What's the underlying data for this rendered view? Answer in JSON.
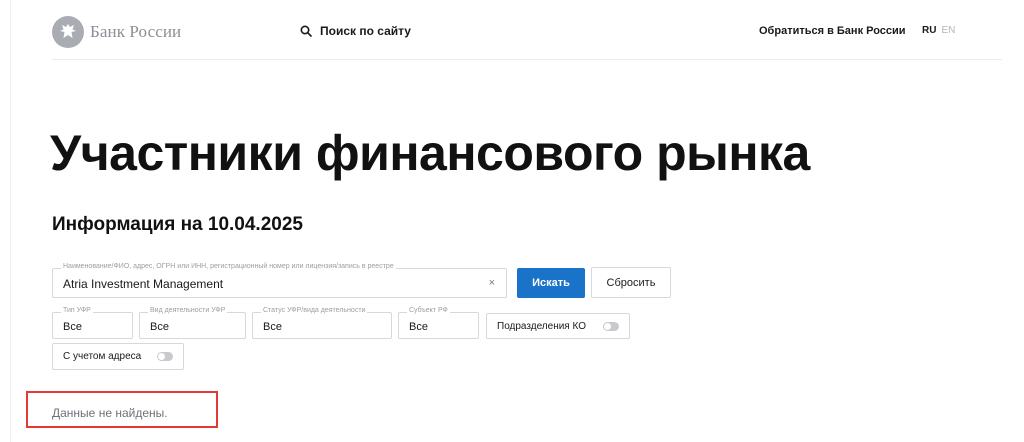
{
  "header": {
    "logo_text": "Банк России",
    "search_label": "Поиск по сайту",
    "contact_label": "Обратиться в Банк России",
    "lang_ru": "RU",
    "lang_en": "EN"
  },
  "page": {
    "title": "Участники финансового рынка",
    "info_date": "Информация на 10.04.2025"
  },
  "search": {
    "legend": "Наименование/ФИО, адрес, ОГРН или ИНН, регистрационный номер или лицензия/запись в реестре",
    "value": "Atria Investment Management",
    "clear_symbol": "×",
    "submit_label": "Искать",
    "reset_label": "Сбросить"
  },
  "filters": {
    "type": {
      "legend": "Тип УФР",
      "value": "Все"
    },
    "activity": {
      "legend": "Вид деятельности УФР",
      "value": "Все"
    },
    "status": {
      "legend": "Статус УФР/вида деятельности",
      "value": "Все"
    },
    "region": {
      "legend": "Субъект РФ",
      "value": "Все"
    },
    "branches_toggle": {
      "label": "Подразделения КО",
      "on": false
    },
    "address_toggle": {
      "label": "С учетом адреса",
      "on": false
    }
  },
  "result": {
    "message": "Данные не найдены."
  },
  "colors": {
    "accent": "#1a73c8",
    "highlight_border": "#e53935"
  }
}
